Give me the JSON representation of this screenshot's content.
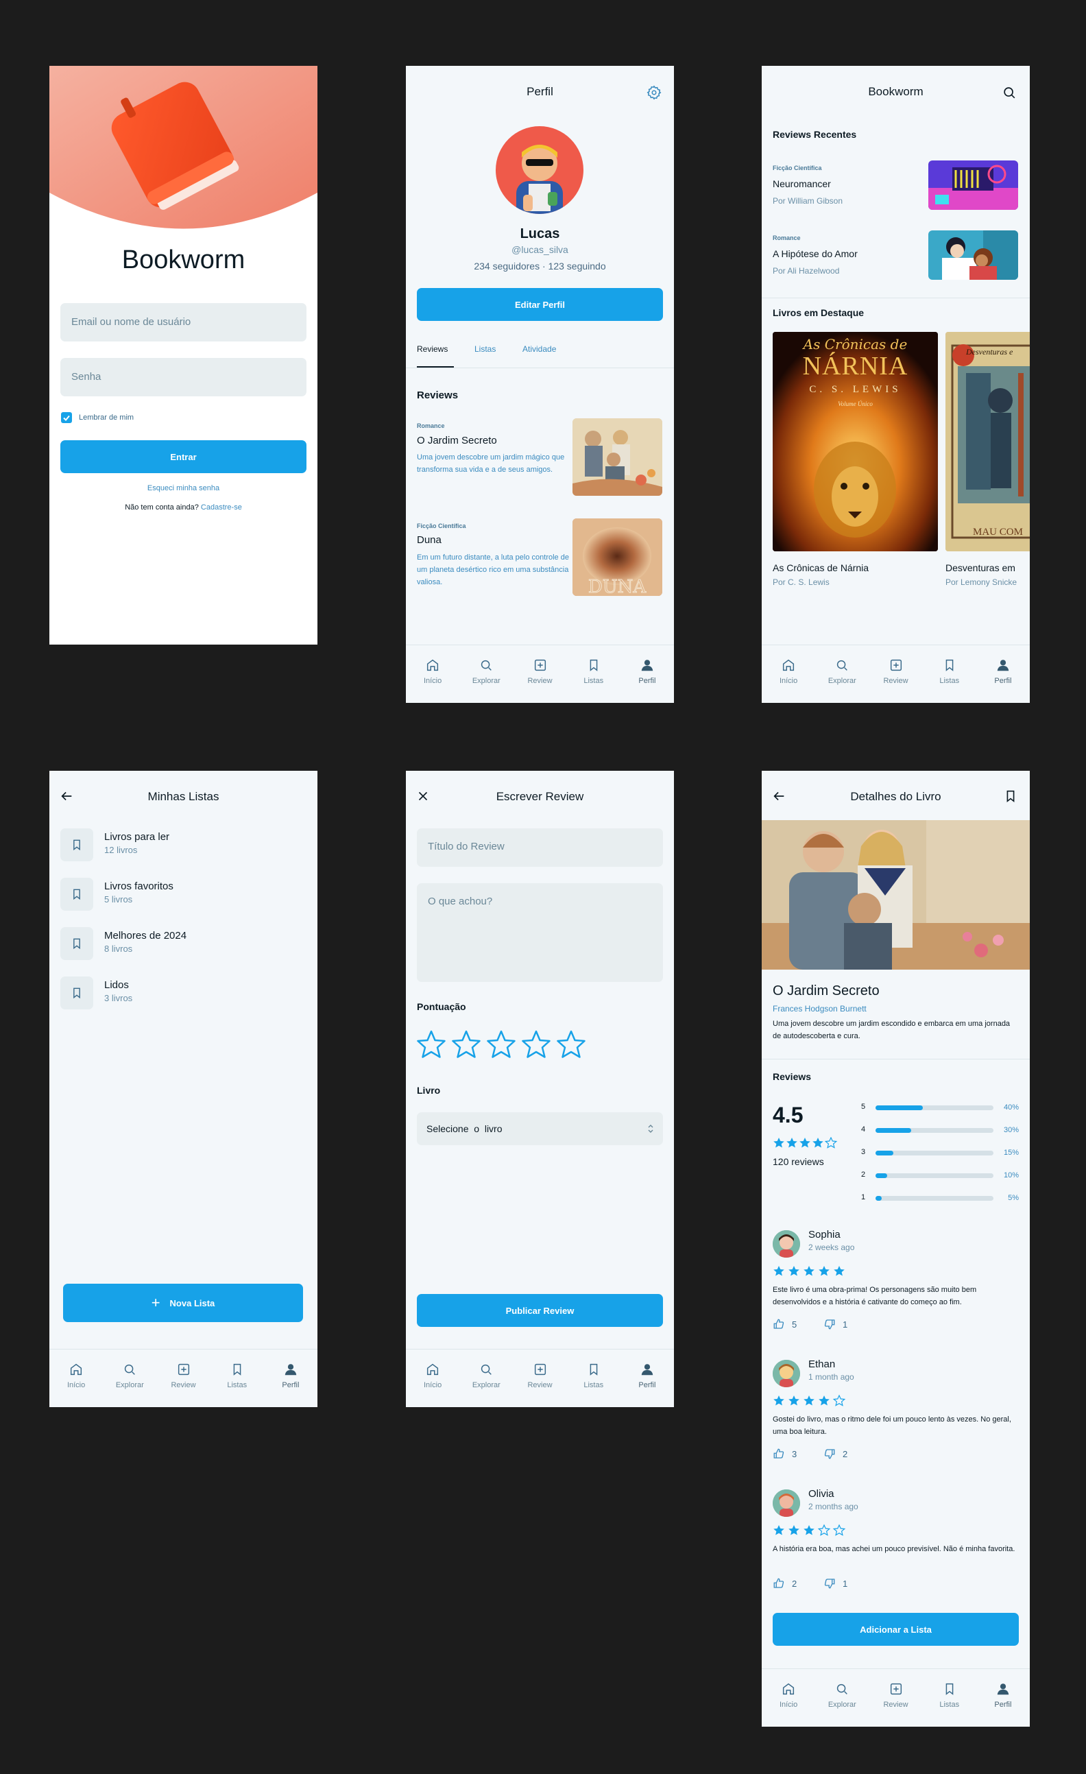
{
  "nav": {
    "home": "Início",
    "explore": "Explorar",
    "review": "Review",
    "lists": "Listas",
    "profile": "Perfil"
  },
  "login": {
    "title": "Bookworm",
    "email_placeholder": "Email ou nome de usuário",
    "password_placeholder": "Senha",
    "remember": "Lembrar de mim",
    "enter": "Entrar",
    "forgot": "Esqueci minha senha",
    "no_account": "Não tem conta ainda?",
    "signup": "Cadastre-se"
  },
  "profile": {
    "header": "Perfil",
    "name": "Lucas",
    "handle": "@lucas_silva",
    "stats": "234 seguidores · 123 seguindo",
    "edit": "Editar Perfil",
    "tabs": [
      "Reviews",
      "Listas",
      "Atividade"
    ],
    "section": "Reviews",
    "items": [
      {
        "genre": "Romance",
        "title": "O Jardim Secreto",
        "desc": "Uma jovem descobre um jardim mágico que transforma sua vida e a de seus amigos."
      },
      {
        "genre": "Ficção Científica",
        "title": "Duna",
        "desc": "Em um futuro distante, a luta pelo controle de um planeta desértico rico em uma substância valiosa."
      }
    ]
  },
  "home": {
    "header": "Bookworm",
    "recent": "Reviews Recentes",
    "recent_items": [
      {
        "genre": "Ficção Científica",
        "title": "Neuromancer",
        "author": "Por William Gibson"
      },
      {
        "genre": "Romance",
        "title": "A Hipótese do Amor",
        "author": "Por Ali Hazelwood"
      }
    ],
    "featured": "Livros em Destaque",
    "featured_items": [
      {
        "title": "As Crônicas de Nárnia",
        "author": "Por C. S. Lewis",
        "cover_top": "As Crônicas de",
        "cover_main": "NÁRNIA",
        "cover_author": "C. S. LEWIS",
        "cover_sub": "Volume Único"
      },
      {
        "title": "Desventuras em",
        "author": "Por Lemony Snicke",
        "cover_top": "Desventuras e",
        "cover_bottom": "MAU COM"
      }
    ]
  },
  "lists": {
    "header": "Minhas Listas",
    "items": [
      {
        "name": "Livros para ler",
        "count": "12 livros"
      },
      {
        "name": "Livros favoritos",
        "count": "5 livros"
      },
      {
        "name": "Melhores de 2024",
        "count": "8 livros"
      },
      {
        "name": "Lidos",
        "count": "3 livros"
      }
    ],
    "new": "Nova Lista"
  },
  "write": {
    "header": "Escrever Review",
    "title_placeholder": "Título do Review",
    "body_placeholder": "O que achou?",
    "score": "Pontuação",
    "book": "Livro",
    "select": "Selecione  o  livro",
    "publish": "Publicar Review"
  },
  "details": {
    "header": "Detalhes do Livro",
    "title": "O Jardim Secreto",
    "author": "Frances Hodgson Burnett",
    "desc": "Uma jovem descobre um jardim escondido e embarca em uma jornada de autodescoberta e cura.",
    "reviews_label": "Reviews",
    "rating": "4.5",
    "rating_value": 4.5,
    "count": "120 reviews",
    "distribution": [
      {
        "star": "5",
        "pct": "40%",
        "value": 40
      },
      {
        "star": "4",
        "pct": "30%",
        "value": 30
      },
      {
        "star": "3",
        "pct": "15%",
        "value": 15
      },
      {
        "star": "2",
        "pct": "10%",
        "value": 10
      },
      {
        "star": "1",
        "pct": "5%",
        "value": 5
      }
    ],
    "reviews": [
      {
        "name": "Sophia",
        "time": "2 weeks ago",
        "stars": 5,
        "text": "Este livro é uma obra-prima! Os personagens são muito bem desenvolvidos e a história é cativante do começo ao fim.",
        "likes": "5",
        "comments": "1"
      },
      {
        "name": "Ethan",
        "time": "1 month ago",
        "stars": 4,
        "text": "Gostei do livro, mas o ritmo dele foi um pouco lento às vezes. No geral, uma boa leitura.",
        "likes": "3",
        "comments": "2"
      },
      {
        "name": "Olivia",
        "time": "2 months ago",
        "stars": 3,
        "text": "A história era boa, mas achei um pouco previsível. Não é minha favorita.",
        "likes": "2",
        "comments": "1"
      }
    ],
    "add": "Adicionar a Lista"
  },
  "colors": {
    "accent": "#17a2e8",
    "bg": "#1c1c1c",
    "screen": "#f3f7fa",
    "field": "#e8eef0"
  }
}
